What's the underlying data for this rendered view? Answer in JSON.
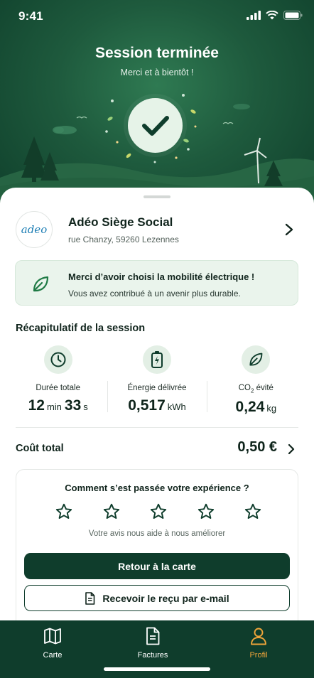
{
  "status_bar": {
    "time": "9:41"
  },
  "hero": {
    "title": "Session terminée",
    "subtitle": "Merci et à bientôt !"
  },
  "station": {
    "logo_text": "adeo",
    "name": "Adéo Siège Social",
    "address": "rue Chanzy, 59260 Lezennes"
  },
  "eco_banner": {
    "line1": "Merci d’avoir choisi la mobilité électrique !",
    "line2": "Vous avez contribué à un avenir plus durable."
  },
  "summary": {
    "title": "Récapitulatif de la session",
    "duration": {
      "label": "Durée totale",
      "minutes": "12",
      "minutes_unit": "min",
      "seconds": "33",
      "seconds_unit": "s"
    },
    "energy": {
      "label": "Énergie délivrée",
      "value": "0,517",
      "unit": "kWh"
    },
    "co2": {
      "label_main": "CO",
      "label_sub": "2",
      "label_rest": " évité",
      "value": "0,24",
      "unit": "kg"
    }
  },
  "total": {
    "label": "Coût total",
    "value": "0,50 €"
  },
  "feedback": {
    "question": "Comment s’est passée votre expérience ?",
    "star_count": 5,
    "rating": 0,
    "hint": "Votre avis nous aide à nous améliorer"
  },
  "actions": {
    "primary": "Retour à la carte",
    "secondary": "Recevoir le reçu par e-mail"
  },
  "tabs": [
    {
      "label": "Carte",
      "icon": "map-icon",
      "active": false
    },
    {
      "label": "Factures",
      "icon": "invoice-icon",
      "active": false
    },
    {
      "label": "Profil",
      "icon": "profile-icon",
      "active": true
    }
  ],
  "colors": {
    "primary": "#0f3d2c",
    "accent": "#f0a53a",
    "success_bg": "#eaf4ec",
    "icon_green": "#1f7a45"
  }
}
